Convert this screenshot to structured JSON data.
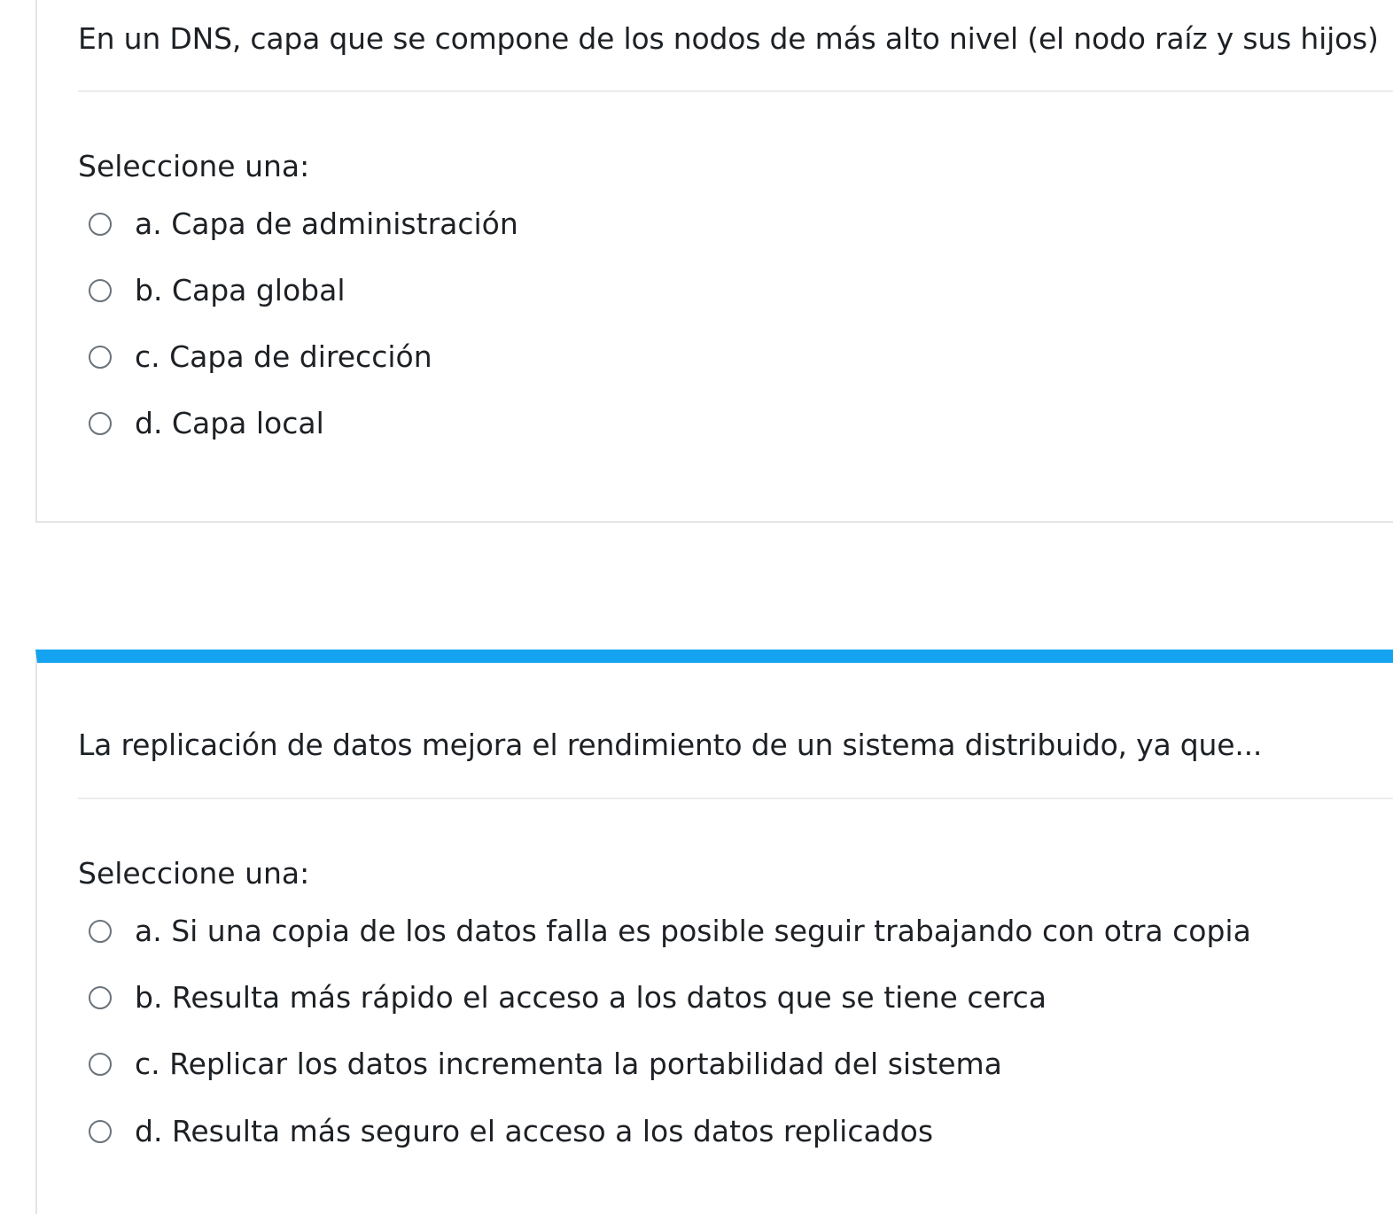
{
  "questions": [
    {
      "text": "En un DNS, capa que se compone de los nodos de más alto nivel (el nodo raíz y sus hijos)",
      "prompt": "Seleccione una:",
      "options": [
        {
          "label": "a. Capa de administración",
          "selected": false
        },
        {
          "label": "b. Capa global",
          "selected": false
        },
        {
          "label": "c. Capa de dirección",
          "selected": false
        },
        {
          "label": "d. Capa local",
          "selected": false
        }
      ]
    },
    {
      "text": "La replicación de datos mejora el rendimiento de un sistema distribuido, ya que...",
      "prompt": "Seleccione una:",
      "options": [
        {
          "label": "a. Si una copia de los datos falla es posible seguir trabajando con otra copia",
          "selected": false
        },
        {
          "label": "b. Resulta más rápido el acceso a los datos que se tiene cerca",
          "selected": false
        },
        {
          "label": "c. Replicar los datos incrementa la portabilidad del sistema",
          "selected": false
        },
        {
          "label": "d. Resulta más seguro el acceso a los datos replicados",
          "selected": false
        }
      ]
    }
  ],
  "colors": {
    "accent_bar": "#13a3f0",
    "card_border": "#e4e4e4",
    "text": "#1d2125",
    "radio_border": "#6a737b"
  }
}
